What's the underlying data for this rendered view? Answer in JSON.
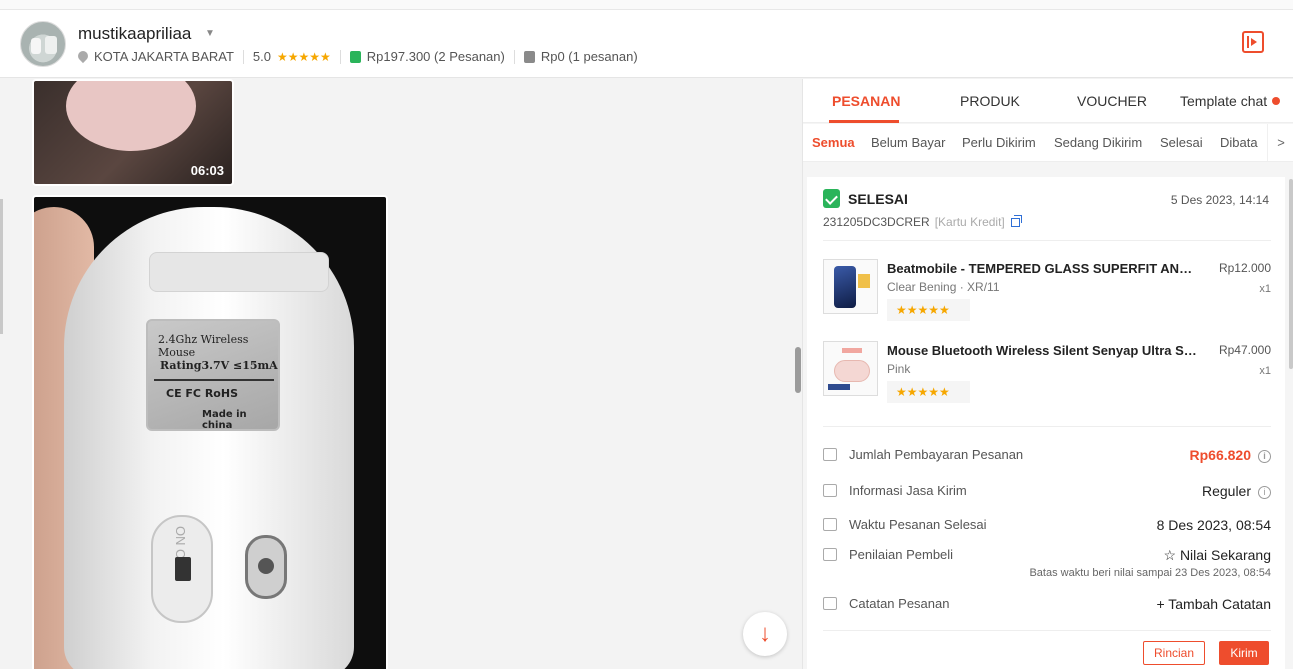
{
  "header": {
    "username": "mustikaapriliaa",
    "location": "KOTA JAKARTA BARAT",
    "rating": "5.0",
    "stars": "★★★★★",
    "paid_summary": "Rp197.300 (2 Pesanan)",
    "unpaid_summary": "Rp0 (1 pesanan)",
    "colors": {
      "paid_icon": "#2ab45a",
      "unpaid_icon": "#8a8a8a",
      "accent": "#ee4d2d"
    }
  },
  "chat": {
    "video_duration": "06:03",
    "photo_label": {
      "line1": "2.4Ghz Wireless  Mouse",
      "line2": "Rating3.7V  ≤15mA",
      "line3": "CE    FC    RoHS",
      "line4": "Made in china"
    },
    "switch_text": "ON  OFF",
    "scroll_down_icon": "arrow-down-icon"
  },
  "panel": {
    "tabs": [
      {
        "label": "PESANAN"
      },
      {
        "label": "PRODUK"
      },
      {
        "label": "VOUCHER"
      },
      {
        "label": "Template chat"
      }
    ],
    "subtabs": [
      {
        "label": "Semua"
      },
      {
        "label": "Belum Bayar"
      },
      {
        "label": "Perlu Dikirim"
      },
      {
        "label": "Sedang Dikirim"
      },
      {
        "label": "Selesai"
      },
      {
        "label": "Dibata"
      }
    ],
    "order": {
      "status": "SELESAI",
      "date": "5 Des 2023, 14:14",
      "id": "231205DC3DCRER",
      "payment": "[Kartu Kredit]",
      "items": [
        {
          "name": "Beatmobile - TEMPERED GLASS SUPERFIT ANTI GORES",
          "variant": "Clear Bening · XR/11",
          "price": "Rp12.000",
          "qty": "x1",
          "stars": "★★★★★"
        },
        {
          "name": "Mouse Bluetooth Wireless Silent Senyap Ultra Slim",
          "variant": "Pink",
          "price": "Rp47.000",
          "qty": "x1",
          "stars": "★★★★★"
        }
      ],
      "rows": {
        "payment_label": "Jumlah Pembayaran Pesanan",
        "payment_value": "Rp66.820",
        "shipping_label": "Informasi Jasa Kirim",
        "shipping_value": "Reguler",
        "completed_label": "Waktu Pesanan Selesai",
        "completed_value": "8 Des 2023, 08:54",
        "review_label": "Penilaian Pembeli",
        "review_action": "☆ Nilai Sekarang",
        "review_note": "Batas waktu beri nilai sampai 23 Des 2023, 08:54",
        "note_label": "Catatan Pesanan",
        "note_action": "+ Tambah Catatan"
      },
      "buttons": {
        "details": "Rincian",
        "send": "Kirim"
      }
    }
  }
}
